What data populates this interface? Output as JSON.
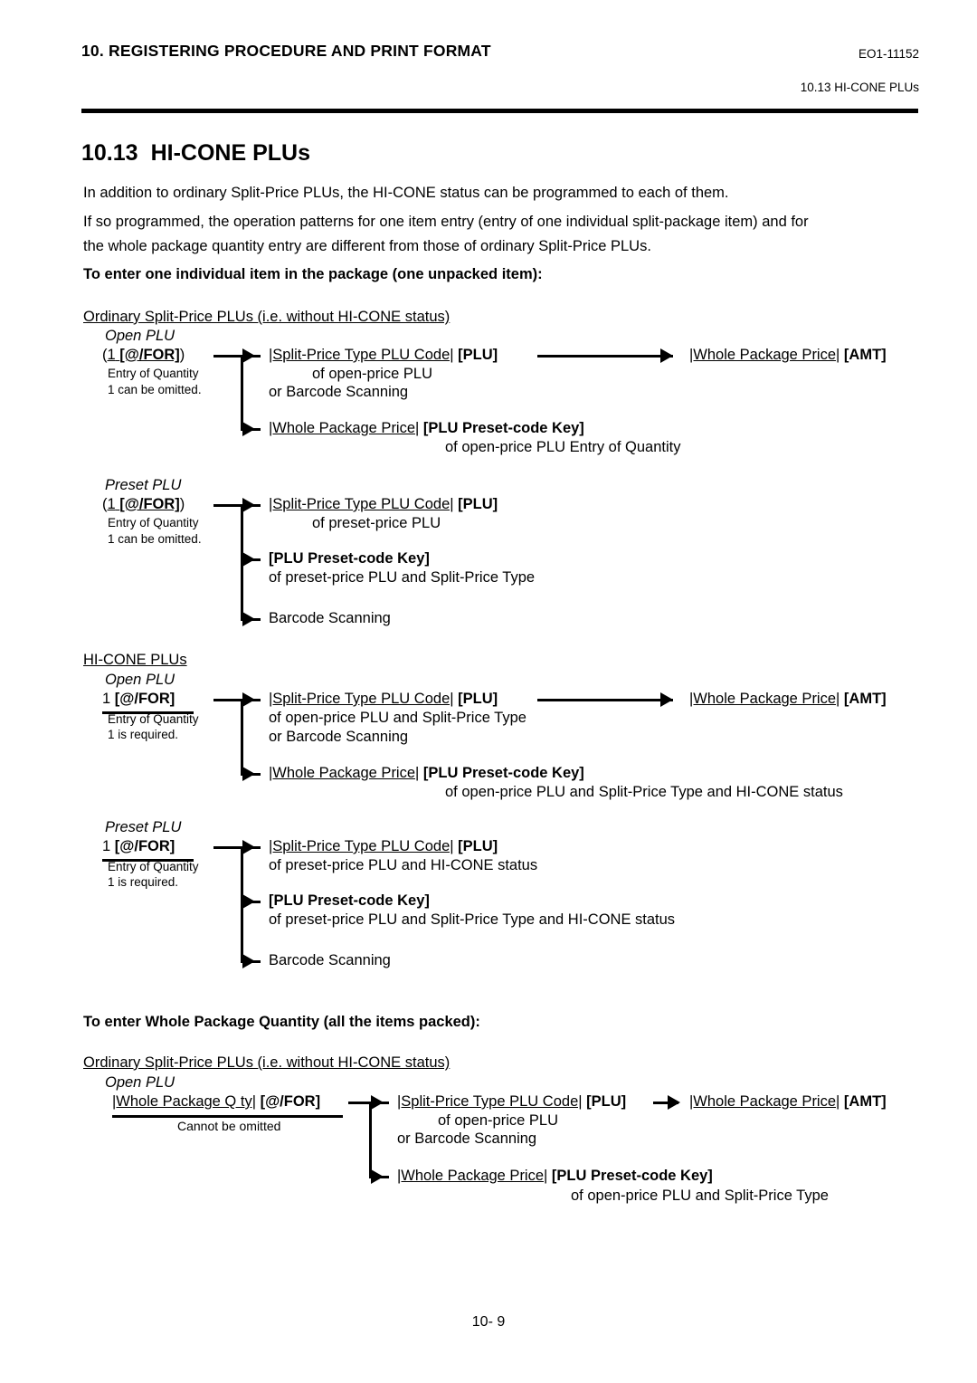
{
  "header": {
    "chapter_title": "10. REGISTERING PROCEDURE AND PRINT FORMAT",
    "doc_code": "EO1-11152",
    "running_head": "10.13 HI-CONE PLUs"
  },
  "section": {
    "number": "10.13",
    "title": "HI-CONE PLUs"
  },
  "intro": {
    "line1": "In addition to ordinary Split-Price PLUs, the HI-CONE status can be programmed to each of them.",
    "line2": "If so programmed, the operation patterns for one item entry (entry of one individual split-package item) and for",
    "line3": "the whole package quantity entry are different from those of ordinary Split-Price PLUs."
  },
  "headings": {
    "one_item": "To enter one individual item in the package (one unpacked item):",
    "whole_package": "To enter Whole Package Quantity (all the items packed):"
  },
  "group_labels": {
    "ordinary": "Ordinary Split-Price PLUs (i.e. without HI-CONE status)",
    "hicone": "HI-CONE PLUs",
    "open_plu": "Open PLU",
    "preset_plu": "Preset PLU"
  },
  "blocks": {
    "ord_open": {
      "start_open_paren": "(",
      "start_qty": "1",
      "start_key": "[@/FOR]",
      "start_close_paren": ")",
      "note1": "Entry of Quantity",
      "note2": "1 can be omitted.",
      "b1_code": "|Split-Price Type PLU Code|",
      "b1_key": "[PLU]",
      "b1_sub1": "of open-price PLU",
      "b1_sub2": "or Barcode Scanning",
      "b2_price": "|Whole Package Price|",
      "b2_key": "[PLU Preset-code Key]",
      "b2_sub": "of open-price PLU Entry of Quantity",
      "right_price": "|Whole Package Price|",
      "right_key": "[AMT]"
    },
    "ord_preset": {
      "start_open_paren": "(",
      "start_qty": "1",
      "start_key": "[@/FOR]",
      "start_close_paren": ")",
      "note1": "Entry of Quantity",
      "note2": "1 can be omitted.",
      "b1_code": "|Split-Price Type PLU Code|",
      "b1_key": "[PLU]",
      "b1_sub": "of preset-price PLU",
      "b2_key": "[PLU Preset-code Key]",
      "b2_sub": "of preset-price PLU and Split-Price Type",
      "b3": "Barcode Scanning"
    },
    "hic_open": {
      "start_qty": "1",
      "start_key": "[@/FOR]",
      "note1": "Entry of Quantity",
      "note2": "1 is required.",
      "b1_code": "|Split-Price Type PLU Code|",
      "b1_key": "[PLU]",
      "b1_sub1": "of open-price PLU and Split-Price Type",
      "b1_sub2": "or Barcode Scanning",
      "b2_price": "|Whole Package Price|",
      "b2_key": "[PLU Preset-code Key]",
      "b2_sub": "of open-price PLU and Split-Price Type and HI-CONE status",
      "right_price": "|Whole Package Price|",
      "right_key": "[AMT]"
    },
    "hic_preset": {
      "start_qty": "1",
      "start_key": "[@/FOR]",
      "note1": "Entry of Quantity",
      "note2": "1 is required.",
      "b1_code": "|Split-Price Type PLU Code|",
      "b1_key": "[PLU]",
      "b1_sub": "of preset-price PLU and HI-CONE status",
      "b2_key": "[PLU Preset-code Key]",
      "b2_sub": "of preset-price PLU and Split-Price Type and HI-CONE status",
      "b3": "Barcode Scanning"
    },
    "whole_ord_open": {
      "start_qty": "|Whole Package Q ty|",
      "start_key": "[@/FOR]",
      "note": "Cannot be omitted",
      "b1_code": "|Split-Price Type PLU Code|",
      "b1_key": "[PLU]",
      "b1_sub1": "of open-price PLU",
      "b1_sub2": "or Barcode Scanning",
      "b1_right_price": "|Whole Package Price|",
      "b1_right_key": "[AMT]",
      "b2_price": "|Whole Package Price|",
      "b2_key": "[PLU Preset-code Key]",
      "b2_sub": "of open-price PLU and Split-Price Type"
    }
  },
  "footer": {
    "page": "10- 9"
  }
}
